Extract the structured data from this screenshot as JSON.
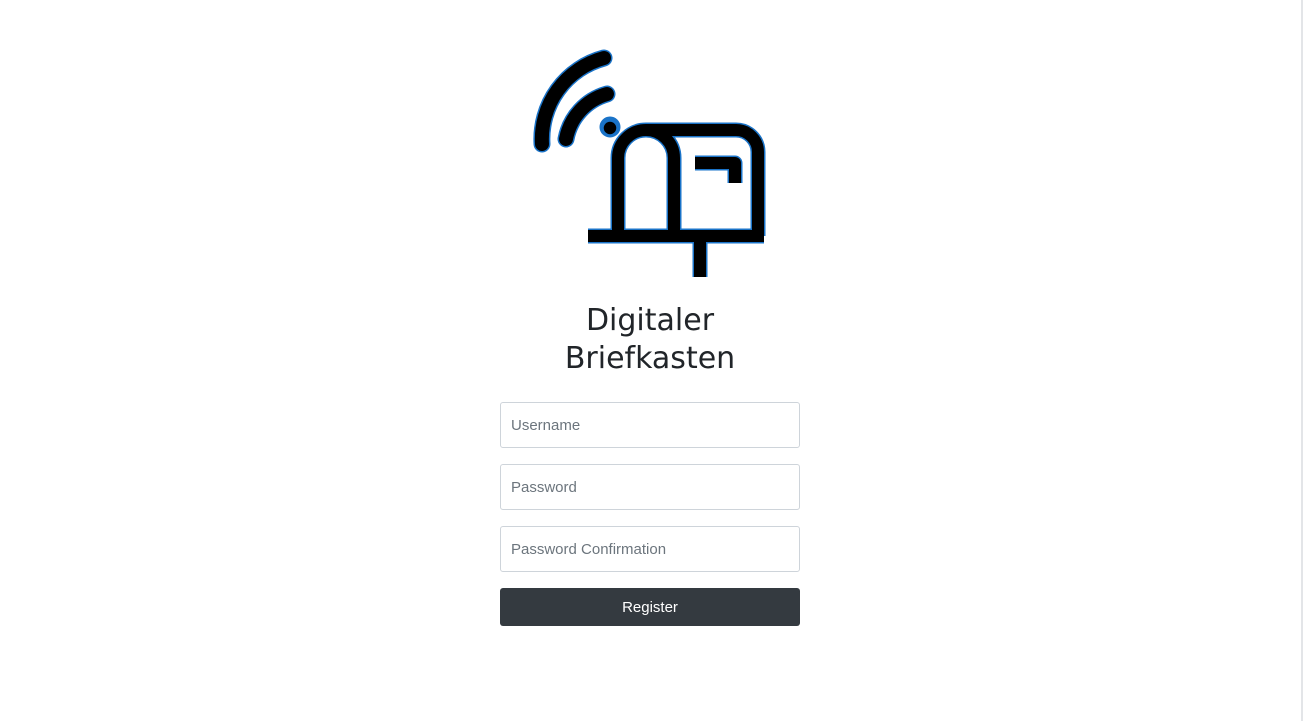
{
  "logo": {
    "icon": "mailbox-wifi-icon",
    "stroke_color": "#000000",
    "outline_color": "#1a73c8"
  },
  "title": {
    "line1": "Digitaler",
    "line2": "Briefkasten"
  },
  "form": {
    "username_placeholder": "Username",
    "password_placeholder": "Password",
    "password_confirmation_placeholder": "Password Confirmation",
    "register_label": "Register"
  },
  "colors": {
    "button_bg": "#343a40",
    "text": "#212529",
    "input_border": "#ced4da"
  }
}
